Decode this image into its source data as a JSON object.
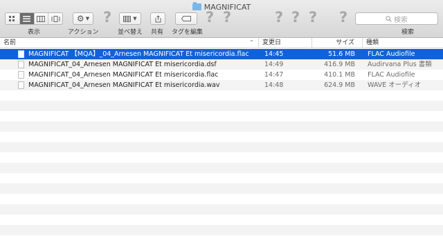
{
  "window": {
    "title": "MAGNIFICAT"
  },
  "toolbar": {
    "view_label": "表示",
    "action_label": "アクション",
    "arrange_label": "並べ替え",
    "share_label": "共有",
    "tags_label": "タグを編集",
    "search_label": "検索",
    "search_placeholder": "検索",
    "unknown_glyph": "?"
  },
  "columns": {
    "name": "名前",
    "date": "変更日",
    "size": "サイズ",
    "kind": "種類"
  },
  "files": [
    {
      "name": "MAGNIFICAT 【MQA】_04_Arnesen  MAGNIFICAT  Et misericordia.flac",
      "date": "14:45",
      "size": "51.6 MB",
      "kind": "FLAC Audiofile",
      "selected": true
    },
    {
      "name": "MAGNIFICAT_04_Arnesen  MAGNIFICAT  Et misericordia.dsf",
      "date": "14:49",
      "size": "416.9 MB",
      "kind": "Audirvana Plus 書類",
      "selected": false
    },
    {
      "name": "MAGNIFICAT_04_Arnesen  MAGNIFICAT  Et misericordia.flac",
      "date": "14:47",
      "size": "410.1 MB",
      "kind": "FLAC Audiofile",
      "selected": false
    },
    {
      "name": "MAGNIFICAT_04_Arnesen  MAGNIFICAT  Et misericordia.wav",
      "date": "14:48",
      "size": "624.9 MB",
      "kind": "WAVE オーディオ",
      "selected": false
    }
  ],
  "colors": {
    "selection": "#1261d8",
    "folder": "#7ab6e8"
  },
  "icons": [
    "folder-icon",
    "icon-view-icon",
    "list-view-icon",
    "column-view-icon",
    "coverflow-view-icon",
    "gear-icon",
    "chevron-down-icon",
    "arrange-grid-icon",
    "share-icon",
    "tag-icon",
    "search-icon",
    "sort-ascending-icon",
    "file-icon"
  ]
}
